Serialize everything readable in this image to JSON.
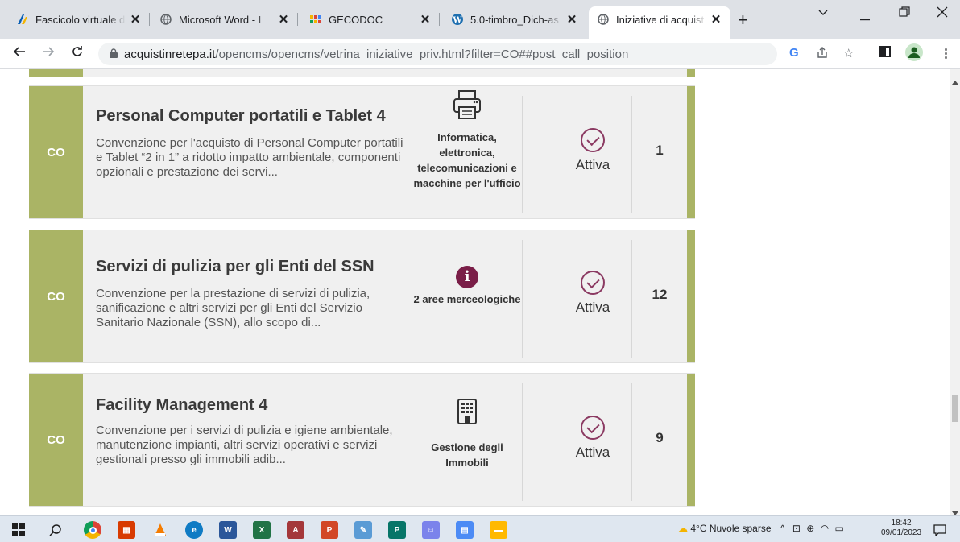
{
  "tabs": [
    {
      "title": "Fascicolo virtuale d",
      "icon": "app-icon"
    },
    {
      "title": "Microsoft Word - I",
      "icon": "globe-icon"
    },
    {
      "title": "GECODOC",
      "icon": "app-icon"
    },
    {
      "title": "5.0-timbro_Dich-as",
      "icon": "wordpress-icon"
    },
    {
      "title": "Iniziative di acquist",
      "icon": "globe-icon"
    }
  ],
  "address": {
    "domain": "acquistinretepa.it",
    "path": "/opencms/opencms/vetrina_iniziative_priv.html?filter=CO##post_call_position"
  },
  "cards": [
    {
      "code": "CO",
      "title": "Personal Computer portatili e Tablet 4",
      "description": "Convenzione per l'acquisto di Personal Computer portatili e Tablet “2 in 1” a ridotto impatto ambientale, componenti opzionali e prestazione dei servi...",
      "category": "Informatica, elettronica, telecomunicazioni e macchine per l'ufficio",
      "category_icon": "printer-icon",
      "status": "Attiva",
      "count": "1"
    },
    {
      "code": "CO",
      "title": "Servizi di pulizia per gli Enti del SSN",
      "description": "Convenzione per la prestazione di servizi di pulizia, sanificazione e altri servizi per gli Enti del Servizio Sanitario Nazionale (SSN), allo scopo di...",
      "category": "2 aree merceologiche",
      "category_icon": "info-icon",
      "status": "Attiva",
      "count": "12"
    },
    {
      "code": "CO",
      "title": "Facility Management 4",
      "description": "Convenzione per i servizi di pulizia e igiene ambientale, manutenzione impianti, altri servizi operativi e servizi gestionali presso gli immobili adib...",
      "category": "Gestione degli Immobili",
      "category_icon": "building-icon",
      "status": "Attiva",
      "count": "9"
    }
  ],
  "taskbar": {
    "weather": "4°C  Nuvole sparse",
    "time": "18:42",
    "date": "09/01/2023"
  },
  "colors": {
    "accent": "#aab465",
    "status": "#8b3a62",
    "info": "#7a1e48"
  }
}
